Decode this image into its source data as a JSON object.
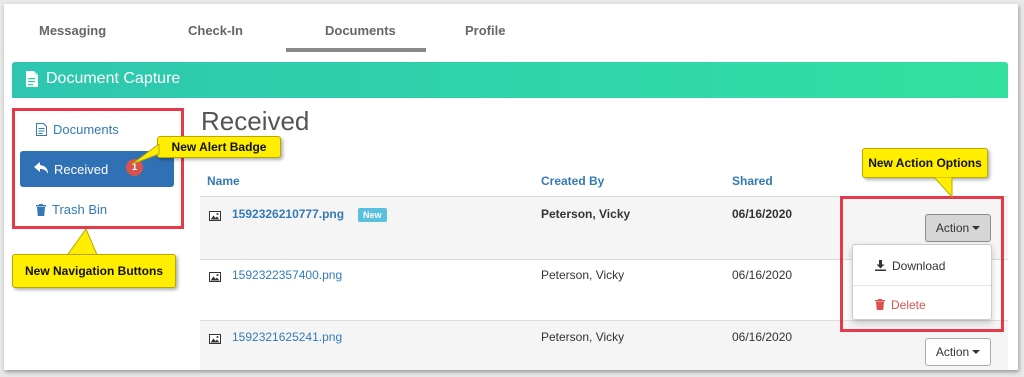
{
  "tabs": [
    {
      "label": "Messaging"
    },
    {
      "label": "Check-In"
    },
    {
      "label": "Documents",
      "active": true
    },
    {
      "label": "Profile"
    }
  ],
  "header": {
    "title": "Document Capture",
    "icon": "document-icon"
  },
  "sidebar": {
    "items": [
      {
        "label": "Documents",
        "icon": "document-icon"
      },
      {
        "label": "Received",
        "icon": "reply-arrow-icon",
        "badge": "1",
        "active": true
      },
      {
        "label": "Trash Bin",
        "icon": "trash-icon"
      }
    ]
  },
  "main": {
    "title": "Received",
    "columns": {
      "name": "Name",
      "created_by": "Created By",
      "shared": "Shared"
    },
    "rows": [
      {
        "name": "1592326210777.png",
        "tag": "New",
        "created_by": "Peterson, Vicky",
        "shared": "06/16/2020",
        "bold": true
      },
      {
        "name": "1592322357400.png",
        "created_by": "Peterson, Vicky",
        "shared": "06/16/2020"
      },
      {
        "name": "1592321625241.png",
        "created_by": "Peterson, Vicky",
        "shared": "06/16/2020"
      }
    ],
    "action_label": "Action",
    "dropdown": {
      "download": "Download",
      "delete": "Delete"
    }
  },
  "callouts": {
    "alert_badge": "New Alert Badge",
    "action_options": "New Action Options",
    "navigation": "New Navigation Buttons"
  },
  "colors": {
    "accent": "#30d6a8",
    "nav_active": "#3070b4",
    "highlight": "#e8394a",
    "callout": "#ffee00",
    "badge": "#d9534f",
    "link": "#337ab7"
  }
}
